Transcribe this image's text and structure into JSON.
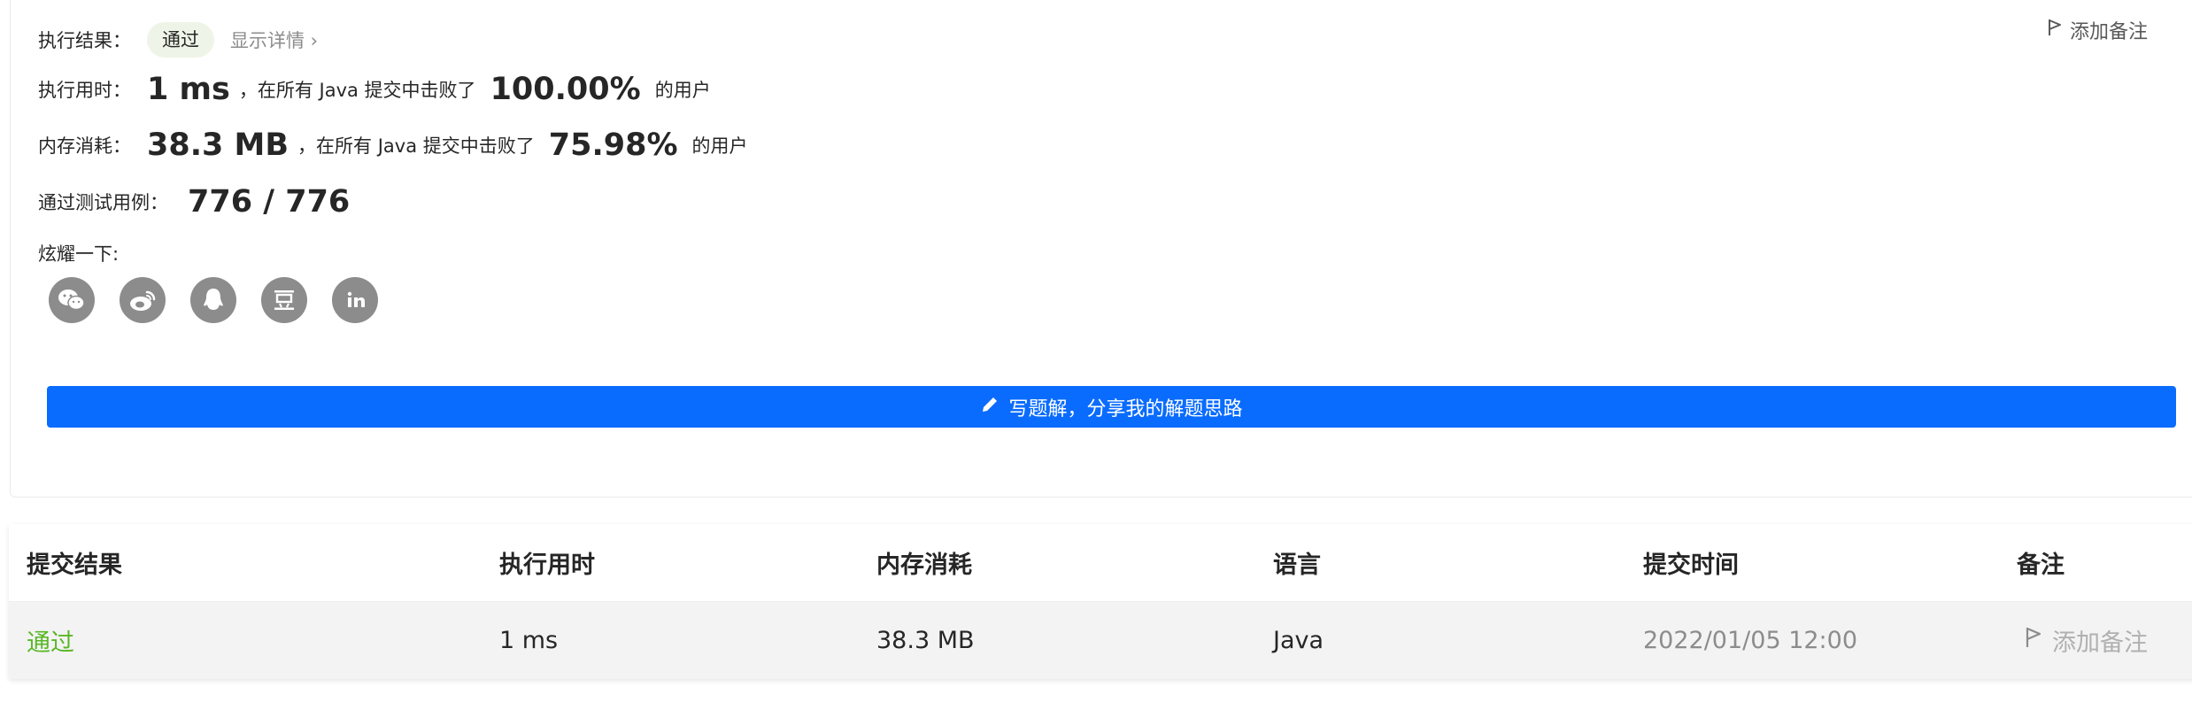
{
  "result": {
    "label": "执行结果：",
    "status": "通过",
    "details_link": "显示详情 ›",
    "add_note": "添加备注"
  },
  "runtime": {
    "label": "执行用时：",
    "value": "1 ms",
    "prefix": "，在所有 Java 提交中击败了",
    "percent": "100.00%",
    "suffix": "的用户"
  },
  "memory": {
    "label": "内存消耗：",
    "value": "38.3 MB",
    "prefix": "，在所有 Java 提交中击败了",
    "percent": "75.98%",
    "suffix": "的用户"
  },
  "testcases": {
    "label": "通过测试用例：",
    "value": "776 / 776"
  },
  "share": {
    "label": "炫耀一下:",
    "icons": [
      "wechat-icon",
      "weibo-icon",
      "qq-icon",
      "douban-icon",
      "linkedin-icon"
    ]
  },
  "cta": {
    "label": "写题解，分享我的解题思路",
    "color": "#0a6cff"
  },
  "table": {
    "headers": [
      "提交结果",
      "执行用时",
      "内存消耗",
      "语言",
      "提交时间",
      "备注"
    ],
    "row": {
      "result": "通过",
      "runtime": "1 ms",
      "memory": "38.3 MB",
      "language": "Java",
      "time": "2022/01/05 12:00",
      "note": "添加备注"
    }
  },
  "colors": {
    "pass_green": "#5ab726",
    "pill_bg": "#eef5e8",
    "icon_gray": "#8c8c8c"
  }
}
